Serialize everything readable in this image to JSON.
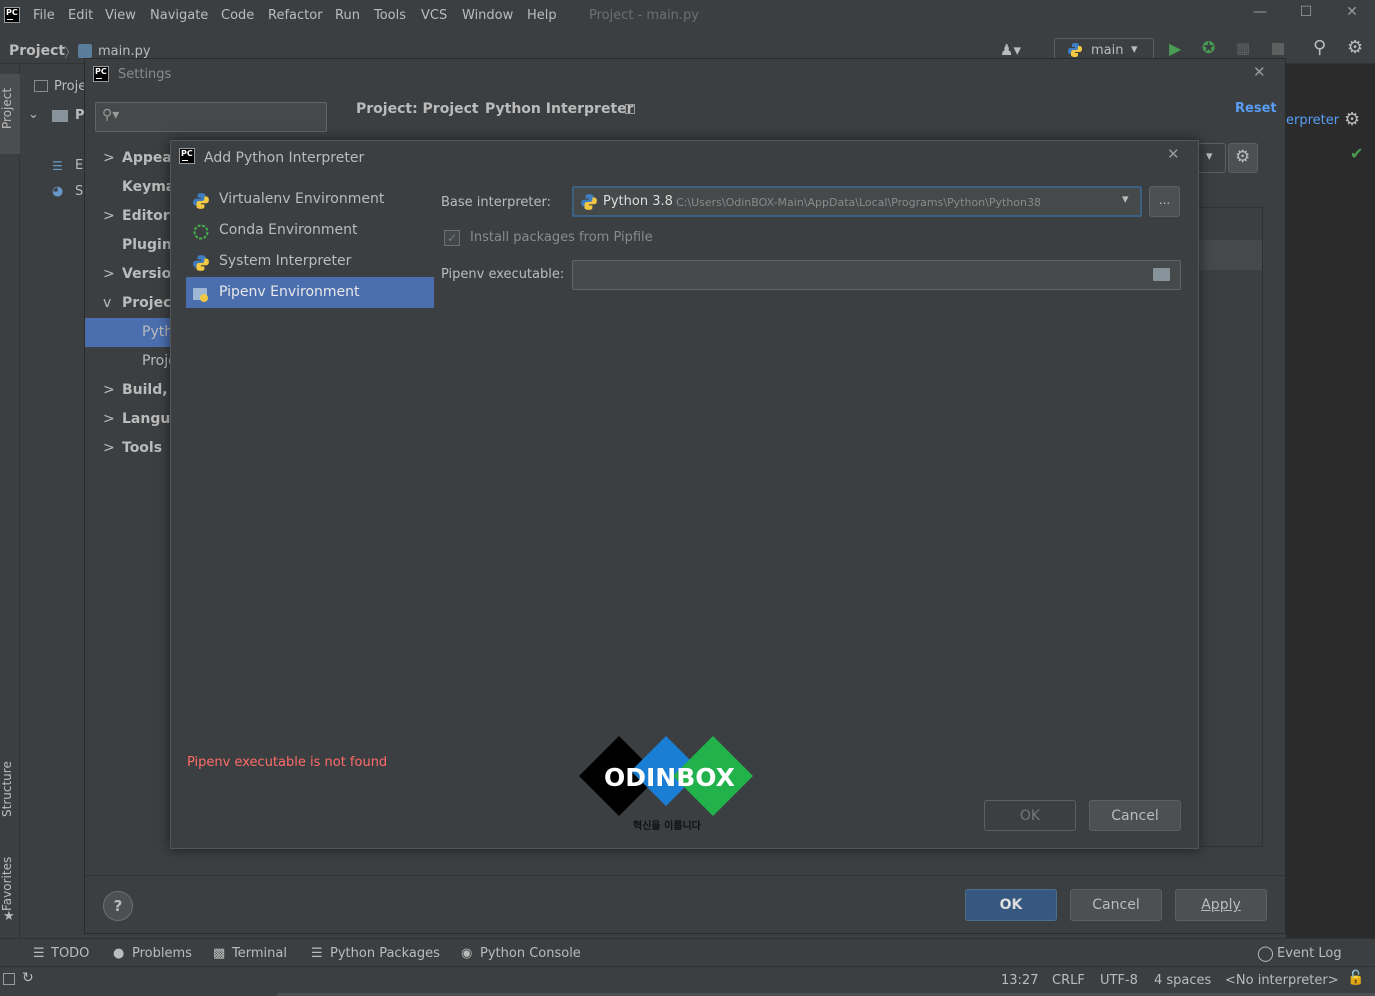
{
  "menu": [
    "File",
    "Edit",
    "View",
    "Navigate",
    "Code",
    "Refactor",
    "Run",
    "Tools",
    "VCS",
    "Window",
    "Help"
  ],
  "window_title": "Project - main.py",
  "nav": {
    "project": "Project",
    "file": "main.py",
    "run_config": "main"
  },
  "project_panel": {
    "header": "Proje",
    "row1": "P",
    "row2": "E",
    "row3": "S"
  },
  "side_tabs": {
    "project": "Project",
    "structure": "Structure",
    "favorites": "Favorites"
  },
  "right_panel": {
    "interpreter_label": "erpreter"
  },
  "settings": {
    "title": "Settings",
    "search_placeholder": "",
    "breadcrumb_project": "Project: Project",
    "breadcrumb_sep": "›",
    "breadcrumb_page": "Python Interpreter",
    "reset": "Reset",
    "tree": [
      {
        "label": "Appear",
        "chev": ">"
      },
      {
        "label": "Keymap",
        "chev": ""
      },
      {
        "label": "Editor",
        "chev": ">"
      },
      {
        "label": "Plugins",
        "chev": ""
      },
      {
        "label": "Versior",
        "chev": ">"
      },
      {
        "label": "Project",
        "chev": "v"
      },
      {
        "label": "Pyth",
        "chev": ""
      },
      {
        "label": "Proje",
        "chev": ""
      },
      {
        "label": "Build, E",
        "chev": ">"
      },
      {
        "label": "Langua",
        "chev": ">"
      },
      {
        "label": "Tools",
        "chev": ">"
      }
    ],
    "help": "?",
    "ok": "OK",
    "cancel": "Cancel",
    "apply": "Apply"
  },
  "add_interpreter": {
    "title": "Add Python Interpreter",
    "envs": [
      "Virtualenv Environment",
      "Conda Environment",
      "System Interpreter",
      "Pipenv Environment"
    ],
    "selected_env": "Pipenv Environment",
    "base_label": "Base interpreter:",
    "base_value": "Python 3.8",
    "base_path": "C:\\Users\\OdinBOX-Main\\AppData\\Local\\Programs\\Python\\Python38",
    "browse": "...",
    "install_label": "Install packages from Pipfile",
    "install_checked": true,
    "pipenv_label": "Pipenv executable:",
    "pipenv_value": "",
    "error": "Pipenv executable is not found",
    "ok": "OK",
    "cancel": "Cancel"
  },
  "watermark": {
    "text": "ODINBOX",
    "tagline": "혁신을 이룹니다"
  },
  "bottom_tabs": [
    "TODO",
    "Problems",
    "Terminal",
    "Python Packages",
    "Python Console"
  ],
  "event_log": "Event Log",
  "status": {
    "position": "13:27",
    "line_sep": "CRLF",
    "encoding": "UTF-8",
    "indent": "4 spaces",
    "interpreter": "<No interpreter>"
  },
  "colors": {
    "accent": "#4b6eaf",
    "error": "#ff6b68",
    "link": "#589df6",
    "run": "#499c54"
  }
}
